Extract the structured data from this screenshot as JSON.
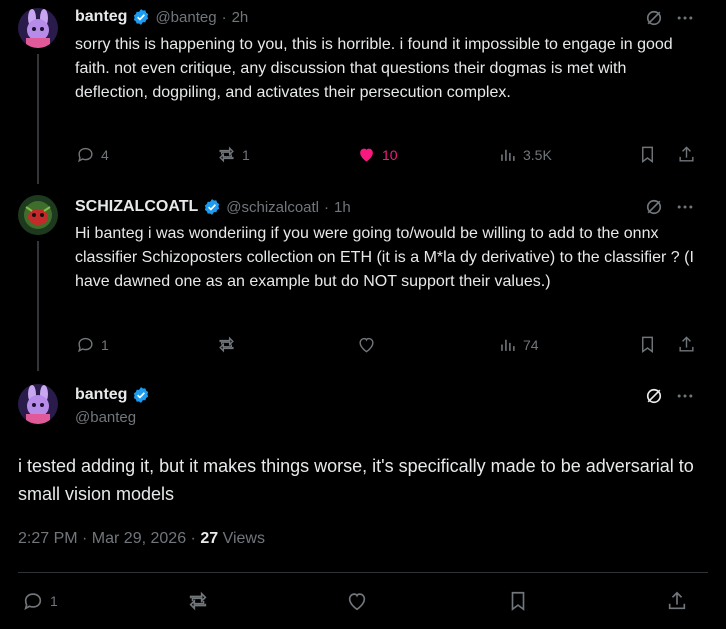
{
  "colors": {
    "accent_like": "#f91880",
    "verified": "#1d9bf0",
    "muted": "#71767b"
  },
  "tweet1": {
    "name": "banteg",
    "handle": "@banteg",
    "sep": "·",
    "time": "2h",
    "text": "sorry this is happening to you, this is horrible. i found it impossible to engage in good faith. not even critique, any discussion that questions their dogmas is met with deflection, dogpiling, and activates their persecution complex.",
    "replies": "4",
    "reposts": "1",
    "likes": "10",
    "views": "3.5K",
    "liked": true
  },
  "tweet2": {
    "name": "SCHIZALCOATL",
    "handle": "@schizalcoatl",
    "sep": "·",
    "time": "1h",
    "text": "Hi banteg i was wonderiing if you were going to/would be willing to add to the onnx classifier Schizoposters collection on ETH (it is a M*la dy derivative) to the classifier ? (I have dawned one as an example but do NOT support their values.)",
    "replies": "1",
    "reposts": "",
    "likes": "",
    "views": "74"
  },
  "main": {
    "name": "banteg",
    "handle": "@banteg",
    "text": "i tested adding it, but it makes things worse, it's specifically made to be adversarial to small vision models",
    "timestamp": "2:27 PM · Mar 29, 2026 ·",
    "views_count": "27",
    "views_label": "Views",
    "replies": "1"
  }
}
